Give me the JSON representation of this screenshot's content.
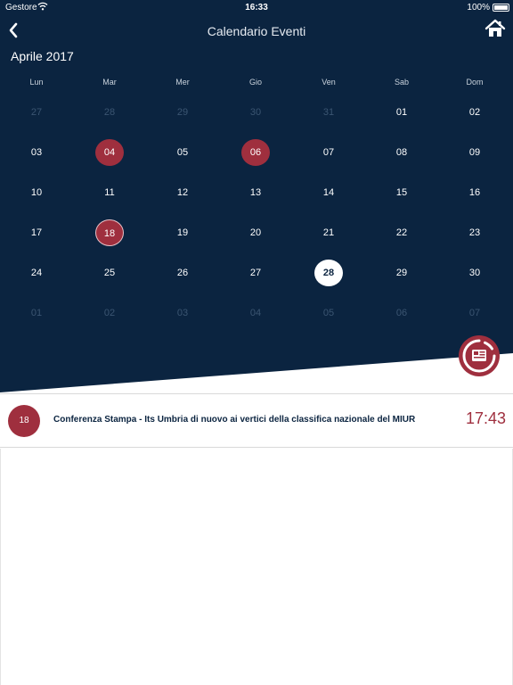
{
  "status_bar": {
    "carrier": "Gestore",
    "time": "16:33",
    "battery": "100%"
  },
  "nav": {
    "title": "Calendario Eventi",
    "back_icon": "chevron-left-icon",
    "home_icon": "home-icon"
  },
  "calendar": {
    "month": "Aprile 2017",
    "weekdays": [
      "Lun",
      "Mar",
      "Mer",
      "Gio",
      "Ven",
      "Sab",
      "Dom"
    ],
    "weeks": [
      [
        {
          "d": "27",
          "s": "dim"
        },
        {
          "d": "28",
          "s": "dim"
        },
        {
          "d": "29",
          "s": "dim"
        },
        {
          "d": "30",
          "s": "dim"
        },
        {
          "d": "31",
          "s": "dim"
        },
        {
          "d": "01",
          "s": ""
        },
        {
          "d": "02",
          "s": ""
        }
      ],
      [
        {
          "d": "03",
          "s": ""
        },
        {
          "d": "04",
          "s": "event"
        },
        {
          "d": "05",
          "s": ""
        },
        {
          "d": "06",
          "s": "event"
        },
        {
          "d": "07",
          "s": ""
        },
        {
          "d": "08",
          "s": ""
        },
        {
          "d": "09",
          "s": ""
        }
      ],
      [
        {
          "d": "10",
          "s": ""
        },
        {
          "d": "11",
          "s": ""
        },
        {
          "d": "12",
          "s": ""
        },
        {
          "d": "13",
          "s": ""
        },
        {
          "d": "14",
          "s": ""
        },
        {
          "d": "15",
          "s": ""
        },
        {
          "d": "16",
          "s": ""
        }
      ],
      [
        {
          "d": "17",
          "s": ""
        },
        {
          "d": "18",
          "s": "event-sel"
        },
        {
          "d": "19",
          "s": ""
        },
        {
          "d": "20",
          "s": ""
        },
        {
          "d": "21",
          "s": ""
        },
        {
          "d": "22",
          "s": ""
        },
        {
          "d": "23",
          "s": ""
        }
      ],
      [
        {
          "d": "24",
          "s": ""
        },
        {
          "d": "25",
          "s": ""
        },
        {
          "d": "26",
          "s": ""
        },
        {
          "d": "27",
          "s": ""
        },
        {
          "d": "28",
          "s": "today"
        },
        {
          "d": "29",
          "s": ""
        },
        {
          "d": "30",
          "s": ""
        }
      ],
      [
        {
          "d": "01",
          "s": "dim"
        },
        {
          "d": "02",
          "s": "dim"
        },
        {
          "d": "03",
          "s": "dim"
        },
        {
          "d": "04",
          "s": "dim"
        },
        {
          "d": "05",
          "s": "dim"
        },
        {
          "d": "06",
          "s": "dim"
        },
        {
          "d": "07",
          "s": "dim"
        }
      ]
    ]
  },
  "fab": {
    "icon": "news-icon"
  },
  "events": [
    {
      "day": "18",
      "title": "Conferenza Stampa - Its Umbria di nuovo ai vertici della classifica nazionale del MIUR",
      "time": "17:43"
    }
  ],
  "colors": {
    "navy": "#0b2440",
    "accent": "#9f2f3e",
    "white": "#ffffff"
  }
}
